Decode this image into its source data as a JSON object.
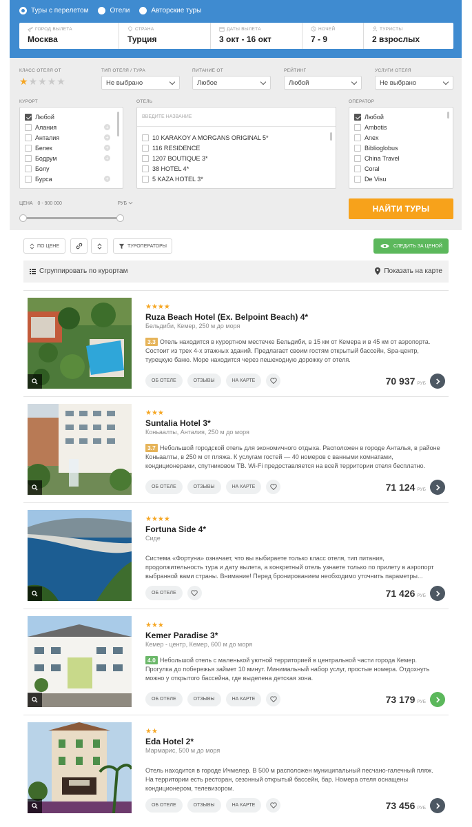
{
  "search": {
    "radios": [
      {
        "label": "Туры с перелетом",
        "checked": true
      },
      {
        "label": "Отели",
        "checked": false
      },
      {
        "label": "Авторские туры",
        "checked": false
      }
    ],
    "fields": [
      {
        "label": "ГОРОД ВЫЛЕТА",
        "value": "Москва",
        "icon": "plane-icon"
      },
      {
        "label": "СТРАНА",
        "value": "Турция",
        "icon": "pin-icon"
      },
      {
        "label": "ДАТЫ ВЫЛЕТА",
        "value": "3 окт - 16 окт",
        "icon": "calendar-icon"
      },
      {
        "label": "НОЧЕЙ",
        "value": "7 - 9",
        "icon": "clock-icon"
      },
      {
        "label": "ТУРИСТЫ",
        "value": "2 взрослых",
        "icon": "person-icon"
      }
    ]
  },
  "filters": {
    "hotel_class_label": "КЛАСС ОТЕЛЯ ОТ",
    "hotel_class_value": 1,
    "hotel_class_max": 5,
    "type_label": "ТИП ОТЕЛЯ / ТУРА",
    "type_value": "Не выбрано",
    "meal_label": "ПИТАНИЕ ОТ",
    "meal_value": "Любое",
    "rating_label": "РЕЙТИНГ",
    "rating_value": "Любой",
    "services_label": "УСЛУГИ ОТЕЛЯ",
    "services_value": "Не выбрано",
    "resort_label": "КУРОРТ",
    "resorts": [
      {
        "name": "Любой",
        "checked": true,
        "plus": false
      },
      {
        "name": "Алания",
        "checked": false,
        "plus": true
      },
      {
        "name": "Анталия",
        "checked": false,
        "plus": true
      },
      {
        "name": "Белек",
        "checked": false,
        "plus": true
      },
      {
        "name": "Бодрум",
        "checked": false,
        "plus": true
      },
      {
        "name": "Болу",
        "checked": false,
        "plus": false
      },
      {
        "name": "Бурса",
        "checked": false,
        "plus": true
      }
    ],
    "hotel_label": "ОТЕЛЬ",
    "hotel_placeholder": "ВВЕДИТЕ НАЗВАНИЕ",
    "hotels": [
      "10 KARAKOY A MORGANS ORIGINAL 5*",
      "116 RESIDENCE",
      "1207 BOUTIQUE 3*",
      "38 HOTEL 4*",
      "5 KAZA HOTEL 3*"
    ],
    "operator_label": "ОПЕРАТОР",
    "operators": [
      {
        "name": "Любой",
        "checked": true
      },
      {
        "name": "Ambotis",
        "checked": false
      },
      {
        "name": "Anex",
        "checked": false
      },
      {
        "name": "Biblioglobus",
        "checked": false
      },
      {
        "name": "China Travel",
        "checked": false
      },
      {
        "name": "Coral",
        "checked": false
      },
      {
        "name": "De Visu",
        "checked": false
      }
    ],
    "price_label": "ЦЕНА",
    "price_range": "0 - 900 000",
    "currency": "РУБ",
    "find_button": "НАЙТИ ТУРЫ"
  },
  "toolbar": {
    "sort_price": "ПО ЦЕНЕ",
    "operators": "ТУРОПЕРАТОРЫ",
    "follow_price": "СЛЕДИТЬ ЗА ЦЕНОЙ"
  },
  "groupbar": {
    "group_label": "Сгруппировать по курортам",
    "map_label": "Показать на карте"
  },
  "hotels": [
    {
      "stars": "★★★★",
      "name": "Ruza Beach Hotel (Ex. Belpoint Beach) 4*",
      "location": "Бельдиби, Кемер, 250 м до моря",
      "rating": "3.3",
      "rating_color": "#e6b45a",
      "description": "Отель находится в курортном местечке Бельдиби, в 15 км от Кемера и в 45 км от аэропорта. Состоит из трех 4-х этажных зданий. Предлагает своим гостям открытый бассейн, Spa-центр, турецкую баню. Море находится через пешеходную дорожку от отеля.",
      "actions": [
        "ОБ ОТЕЛЕ",
        "ОТЗЫВЫ",
        "НА КАРТЕ"
      ],
      "price": "70 937",
      "currency": "РУБ",
      "go_color": "dark"
    },
    {
      "stars": "★★★",
      "name": "Suntalia Hotel 3*",
      "location": "Коньаалты, Анталия, 250 м до моря",
      "rating": "3.7",
      "rating_color": "#e6b45a",
      "description": "Небольшой городской отель для экономичного отдыха. Расположен в городе Анталья, в районе Коньаалты, в 250 м от пляжа. К услугам гостей — 40 номеров с ванными комнатами, кондиционерами, спутниковом ТВ. Wi-Fi предоставляется на всей территории отеля бесплатно.",
      "actions": [
        "ОБ ОТЕЛЕ",
        "ОТЗЫВЫ",
        "НА КАРТЕ"
      ],
      "price": "71 124",
      "currency": "РУБ",
      "go_color": "dark"
    },
    {
      "stars": "★★★★",
      "name": "Fortuna Side 4*",
      "location": "Сиде",
      "rating": "",
      "rating_color": "",
      "description": "Система «Фортуна» означает, что вы выбираете только класс отеля, тип питания, продолжительность тура и дату вылета, а конкретный отель узнаете только по прилету в аэропорт выбранной вами страны. Внимание! Перед бронированием необходимо уточнить параметры...",
      "actions": [
        "ОБ ОТЕЛЕ"
      ],
      "price": "71 426",
      "currency": "РУБ",
      "go_color": "dark"
    },
    {
      "stars": "★★★",
      "name": "Kemer Paradise 3*",
      "location": "Кемер - центр, Кемер, 600 м до моря",
      "rating": "4.0",
      "rating_color": "#6cb86a",
      "description": "Небольшой отель с маленькой уютной территорией в центральной части города Кемер. Прогулка до побережья займет 10 минут. Минимальный набор услуг, простые номера. Отдохнуть можно у открытого бассейна, где выделена детская зона.",
      "actions": [
        "ОБ ОТЕЛЕ",
        "ОТЗЫВЫ",
        "НА КАРТЕ"
      ],
      "price": "73 179",
      "currency": "РУБ",
      "go_color": "green"
    },
    {
      "stars": "★★",
      "name": "Eda Hotel 2*",
      "location": "Мармарис, 500 м до моря",
      "rating": "",
      "rating_color": "",
      "description": "Отель находится в городе Ичмелер. В 500 м расположен муниципальный песчано-галечный пляж. На территории есть ресторан, сезонный открытый бассейн, бар. Номера отеля оснащены кондиционером, телевизором.",
      "actions": [
        "ОБ ОТЕЛЕ",
        "ОТЗЫВЫ",
        "НА КАРТЕ"
      ],
      "price": "73 456",
      "currency": "РУБ",
      "go_color": "dark"
    }
  ]
}
